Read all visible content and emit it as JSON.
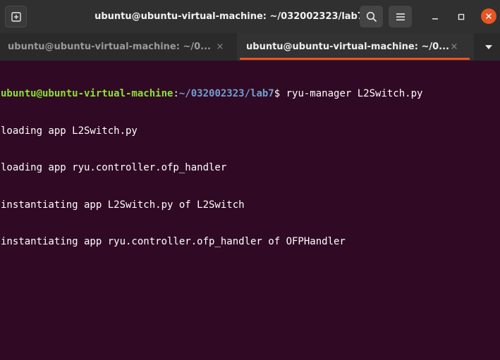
{
  "window": {
    "title": "ubuntu@ubuntu-virtual-machine: ~/032002323/lab7"
  },
  "toolbar": {
    "new_tab_icon": "new-tab-icon",
    "search_icon": "search-icon",
    "menu_icon": "hamburger-menu-icon",
    "minimize_icon": "minimize-icon",
    "maximize_icon": "maximize-icon",
    "close_icon": "close-icon"
  },
  "tabs": [
    {
      "label": "ubuntu@ubuntu-virtual-machine: ~/0...",
      "close": "×",
      "active": false
    },
    {
      "label": "ubuntu@ubuntu-virtual-machine: ~/0...",
      "close": "×",
      "active": true
    }
  ],
  "terminal": {
    "prompt": {
      "user_host": "ubuntu@ubuntu-virtual-machine",
      "colon": ":",
      "path": "~/032002323/lab7",
      "dollar": "$ ",
      "command": "ryu-manager L2Switch.py"
    },
    "output": [
      "loading app L2Switch.py",
      "loading app ryu.controller.ofp_handler",
      "instantiating app L2Switch.py of L2Switch",
      "instantiating app ryu.controller.ofp_handler of OFPHandler"
    ]
  },
  "colors": {
    "terminal_bg": "#300a24",
    "prompt_user": "#8ae234",
    "prompt_path": "#729fcf",
    "accent": "#e95420"
  }
}
